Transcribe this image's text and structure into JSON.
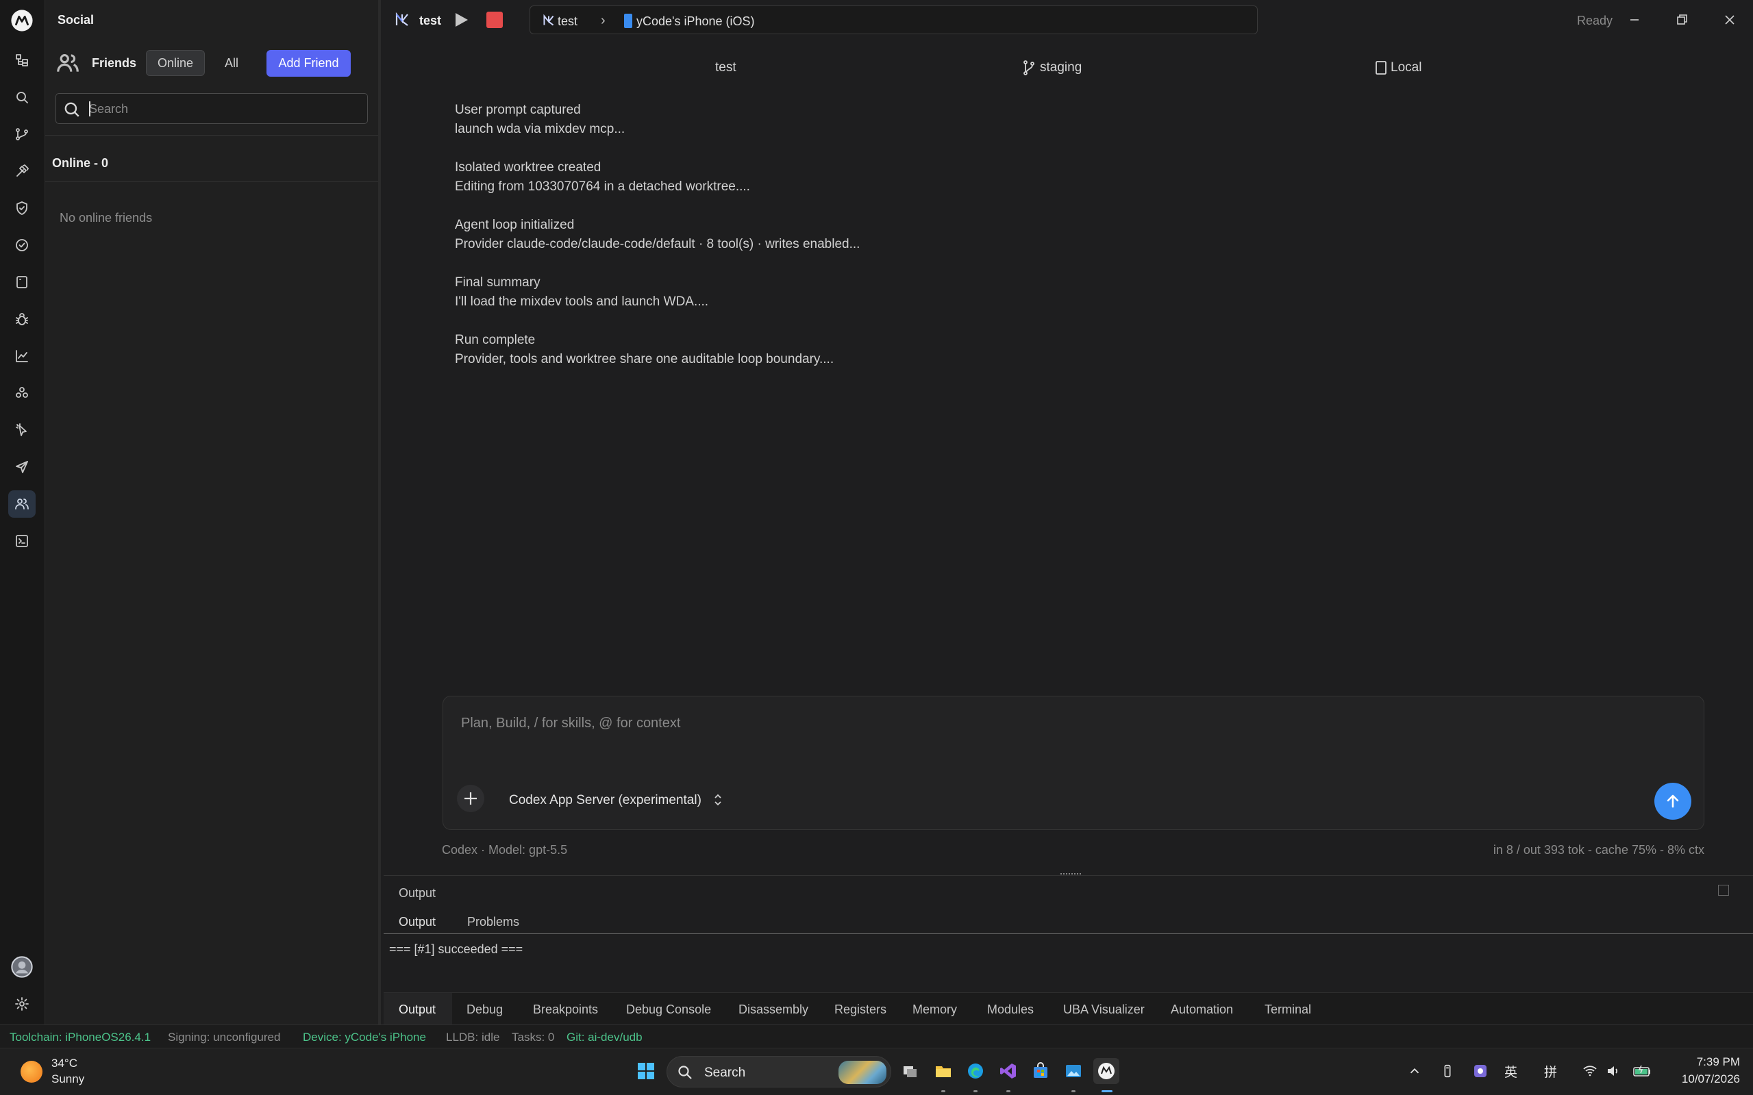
{
  "social": {
    "title": "Social",
    "friends_label": "Friends",
    "tab_online": "Online",
    "tab_all": "All",
    "add_friend": "Add Friend",
    "search_placeholder": "Search",
    "online_header": "Online - 0",
    "empty_state": "No online friends"
  },
  "activity_bar": {
    "icons": [
      "app-logo-icon",
      "explorer-icon",
      "search-icon",
      "source-control-icon",
      "build-hammer-icon",
      "shield-icon",
      "check-circle-icon",
      "device-icon",
      "bug-icon",
      "chart-icon",
      "extensions-icon",
      "cursor-icon",
      "send-icon",
      "friends-icon",
      "terminal-icon",
      "avatar",
      "settings-icon"
    ],
    "active": "friends-icon"
  },
  "titlebar": {
    "project": "test",
    "breadcrumb_project": "test",
    "breadcrumb_separator": "›",
    "breadcrumb_device": "yCode's iPhone (iOS)",
    "status": "Ready"
  },
  "chat_header": {
    "workspace": "test",
    "branch": "staging",
    "location": "Local"
  },
  "chat_log": [
    {
      "title": "User prompt captured",
      "detail": "launch wda via mixdev mcp..."
    },
    {
      "title": "Isolated worktree created",
      "detail": "Editing from 1033070764 in a detached worktree...."
    },
    {
      "title": "Agent loop initialized",
      "detail": "Provider claude-code/claude-code/default · 8 tool(s) · writes enabled..."
    },
    {
      "title": "Final summary",
      "detail": "I'll load the mixdev tools and launch WDA...."
    },
    {
      "title": "Run complete",
      "detail": "Provider, tools and worktree share one auditable loop boundary...."
    }
  ],
  "composer": {
    "placeholder": "Plan, Build, / for skills, @ for context",
    "model_selector": "Codex App Server (experimental)",
    "meta_left": "Codex · Model: gpt-5.5",
    "meta_right": "in 8 / out 393 tok - cache 75% - 8% ctx"
  },
  "output_panel": {
    "title": "Output",
    "tabs": [
      "Output",
      "Problems"
    ],
    "content": "=== [#1] succeeded ==="
  },
  "bottom_tabs": [
    "Output",
    "Debug",
    "Breakpoints",
    "Debug Console",
    "Disassembly",
    "Registers",
    "Memory",
    "Modules",
    "UBA Visualizer",
    "Automation",
    "Terminal"
  ],
  "statusbar": {
    "toolchain": "Toolchain: iPhoneOS26.4.1",
    "signing": "Signing: unconfigured",
    "device": "Device: yCode's iPhone",
    "lldb": "LLDB: idle",
    "tasks": "Tasks: 0",
    "git": "Git: ai-dev/udb"
  },
  "taskbar": {
    "temperature": "34°C",
    "weather": "Sunny",
    "search": "Search",
    "ime_1": "英",
    "ime_2": "拼",
    "time": "7:39 PM",
    "date": "10/07/2026"
  },
  "colors": {
    "accent_blue": "#3a8ef5",
    "discord_purple": "#5865f2",
    "status_green": "#4cc38a",
    "stop_red": "#e64b4b"
  }
}
